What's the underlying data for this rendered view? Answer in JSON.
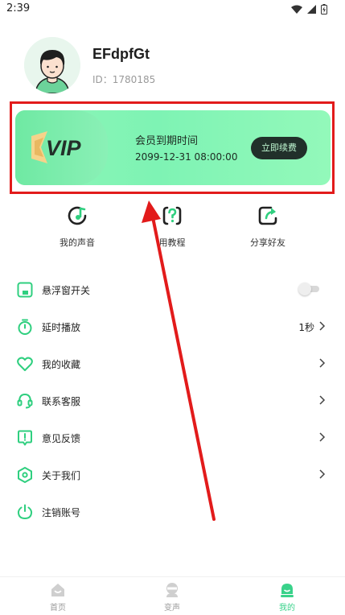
{
  "status_bar": {
    "time": "2:39"
  },
  "profile": {
    "username": "EFdpfGt",
    "user_id": "ID：1780185"
  },
  "vip": {
    "badge_text": "VIP",
    "title": "会员到期时间",
    "expiry": "2099-12-31 08:00:00",
    "renew_label": "立即续费",
    "accent": "#8ef5b7"
  },
  "quick_actions": [
    {
      "label": "我的声音",
      "icon": "voice-icon"
    },
    {
      "label": "用教程",
      "icon": "tutorial-icon"
    },
    {
      "label": "分享好友",
      "icon": "share-icon"
    }
  ],
  "menu": {
    "floating_window": {
      "label": "悬浮窗开关",
      "icon": "floating-window-icon",
      "enabled": false
    },
    "delay_play": {
      "label": "延时播放",
      "value": "1秒",
      "icon": "timer-icon"
    },
    "favorites": {
      "label": "我的收藏",
      "icon": "heart-icon"
    },
    "support": {
      "label": "联系客服",
      "icon": "headset-icon"
    },
    "feedback": {
      "label": "意见反馈",
      "icon": "feedback-icon"
    },
    "about": {
      "label": "关于我们",
      "icon": "about-icon"
    },
    "delete_account": {
      "label": "注销账号",
      "icon": "power-icon"
    }
  },
  "tabs": [
    {
      "label": "首页",
      "icon": "home-icon",
      "active": false
    },
    {
      "label": "变声",
      "icon": "voice-change-icon",
      "active": false
    },
    {
      "label": "我的",
      "icon": "profile-icon",
      "active": true
    }
  ],
  "colors": {
    "accent": "#39d28a",
    "highlight": "#e21b1b"
  }
}
